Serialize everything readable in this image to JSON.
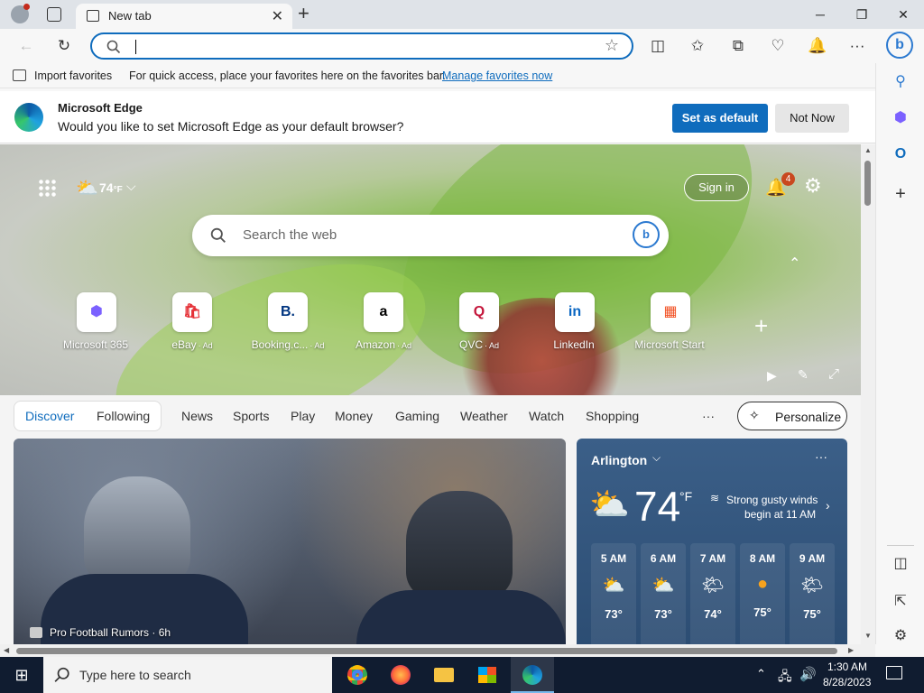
{
  "titlebar": {
    "tab_title": "New tab",
    "new_tab_symbol": "+",
    "minimize": "─",
    "maximize": "❐",
    "close": "✕"
  },
  "toolbar": {
    "address_value": "",
    "icons": [
      "back-icon",
      "refresh-icon",
      "search-icon",
      "star-icon",
      "split-screen-icon",
      "favorites-icon",
      "collections-icon",
      "browser-essentials-icon",
      "notifications-icon",
      "more-icon",
      "copilot-icon"
    ]
  },
  "favbar": {
    "import_label": "Import favorites",
    "message": "For quick access, place your favorites here on the favorites bar.",
    "link": "Manage favorites now"
  },
  "banner": {
    "title": "Microsoft Edge",
    "message": "Would you like to set Microsoft Edge as your default browser?",
    "primary": "Set as default",
    "secondary": "Not Now"
  },
  "hero": {
    "temperature": "74",
    "temp_unit": "°F",
    "search_placeholder": "Search the web",
    "signin": "Sign in",
    "notif_count": "4",
    "tiles": [
      {
        "label": "Microsoft 365",
        "ad": "",
        "glyph": "⬢",
        "color": "#7b61ff"
      },
      {
        "label": "eBay",
        "ad": "· Ad",
        "glyph": "🛍",
        "color": "#e53238"
      },
      {
        "label": "Booking.c...",
        "ad": "· Ad",
        "glyph": "B.",
        "color": "#003580"
      },
      {
        "label": "Amazon",
        "ad": "· Ad",
        "glyph": "a",
        "color": "#000000"
      },
      {
        "label": "QVC",
        "ad": "· Ad",
        "glyph": "Q",
        "color": "#c4163b"
      },
      {
        "label": "LinkedIn",
        "ad": "",
        "glyph": "in",
        "color": "#0a66c2"
      },
      {
        "label": "Microsoft Start",
        "ad": "",
        "glyph": "▦",
        "color": "#f25022"
      }
    ]
  },
  "feed": {
    "tabs": [
      "Discover",
      "Following"
    ],
    "nav": [
      "News",
      "Sports",
      "Play",
      "Money",
      "Gaming",
      "Weather",
      "Watch",
      "Shopping"
    ],
    "more": "···",
    "personalize": "Personalize",
    "article_source": "Pro Football Rumors · 6h"
  },
  "weather": {
    "location": "Arlington",
    "temp": "74",
    "unit": "°F",
    "alert_line1": "Strong gusty winds",
    "alert_line2": "begin at 11 AM",
    "hours": [
      {
        "time": "5 AM",
        "temp": "73°",
        "icon": "partly-cloudy-night-icon"
      },
      {
        "time": "6 AM",
        "temp": "73°",
        "icon": "partly-cloudy-night-icon"
      },
      {
        "time": "7 AM",
        "temp": "74°",
        "icon": "partly-sunny-icon"
      },
      {
        "time": "8 AM",
        "temp": "75°",
        "icon": "sunny-icon"
      },
      {
        "time": "9 AM",
        "temp": "75°",
        "icon": "partly-sunny-icon"
      }
    ]
  },
  "taskbar": {
    "search_placeholder": "Type here to search",
    "time": "1:30 AM",
    "date": "8/28/2023"
  }
}
